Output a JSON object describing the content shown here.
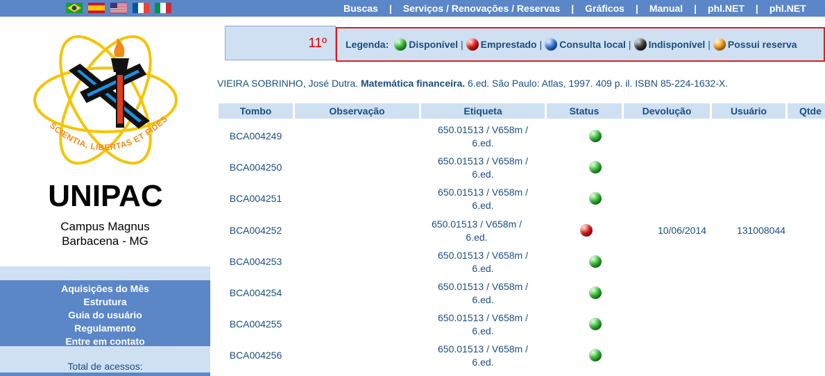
{
  "topbar": {
    "flags": [
      "flag-brazil",
      "flag-spain",
      "flag-usa",
      "flag-france",
      "flag-italy"
    ],
    "nav": [
      "Buscas",
      "Serviços / Renovações / Reservas",
      "Gráficos",
      "Manual",
      "phl.NET",
      "phl.NET"
    ],
    "separator": "|"
  },
  "sidebar": {
    "logo_text": "UNIPAC",
    "logo_motto": "SCIENTIA, LIBERTAS ET FIDES",
    "campus_line1": "Campus Magnus",
    "campus_line2": "Barbacena - MG",
    "menu": [
      "Aquisições do Mês",
      "Estrutura",
      "Guia do usuário",
      "Regulamento",
      "Entre em contato"
    ],
    "total_label": "Total de acessos:"
  },
  "rank": "11º",
  "legend": {
    "label": "Legenda:",
    "items": [
      {
        "color": "green",
        "label": "Disponível"
      },
      {
        "color": "red",
        "label": "Emprestado"
      },
      {
        "color": "blue",
        "label": "Consulta local"
      },
      {
        "color": "black",
        "label": "Indisponível"
      },
      {
        "color": "orange",
        "label": "Possui reserva"
      }
    ],
    "separator": "|"
  },
  "citation": {
    "author": "VIEIRA SOBRINHO, José Dutra. ",
    "title": "Matemática financeira.",
    "rest": " 6.ed. São Paulo: Atlas, 1997. 409 p. il. ISBN 85-224-1632-X."
  },
  "table": {
    "headers": [
      "Tombo",
      "Observação",
      "Etiqueta",
      "Status",
      "Devolução",
      "Usuário",
      "Qtde"
    ],
    "rows": [
      {
        "tombo": "BCA004249",
        "etiqueta1": "650.01513 / V658m /",
        "etiqueta2": "6.ed.",
        "status": "green",
        "devolucao": "",
        "usuario": ""
      },
      {
        "tombo": "BCA004250",
        "etiqueta1": "650.01513 / V658m /",
        "etiqueta2": "6.ed.",
        "status": "green",
        "devolucao": "",
        "usuario": ""
      },
      {
        "tombo": "BCA004251",
        "etiqueta1": "650.01513 / V658m /",
        "etiqueta2": "6.ed.",
        "status": "green",
        "devolucao": "",
        "usuario": ""
      },
      {
        "tombo": "BCA004252",
        "etiqueta1": "650.01513 / V658m /",
        "etiqueta2": "6.ed.",
        "status": "red",
        "devolucao": "10/06/2014",
        "usuario": "131008044"
      },
      {
        "tombo": "BCA004253",
        "etiqueta1": "650.01513 / V658m /",
        "etiqueta2": "6.ed.",
        "status": "green",
        "devolucao": "",
        "usuario": ""
      },
      {
        "tombo": "BCA004254",
        "etiqueta1": "650.01513 / V658m /",
        "etiqueta2": "6.ed.",
        "status": "green",
        "devolucao": "",
        "usuario": ""
      },
      {
        "tombo": "BCA004255",
        "etiqueta1": "650.01513 / V658m /",
        "etiqueta2": "6.ed.",
        "status": "green",
        "devolucao": "",
        "usuario": ""
      },
      {
        "tombo": "BCA004256",
        "etiqueta1": "650.01513 / V658m /",
        "etiqueta2": "6.ed.",
        "status": "green",
        "devolucao": "",
        "usuario": ""
      }
    ]
  },
  "colors": {
    "nav_blue": "#5b86c7",
    "light_blue": "#cfe0f2",
    "text_blue": "#1a4d80",
    "rank_red": "#e00000",
    "highlight_red": "#d42020"
  }
}
